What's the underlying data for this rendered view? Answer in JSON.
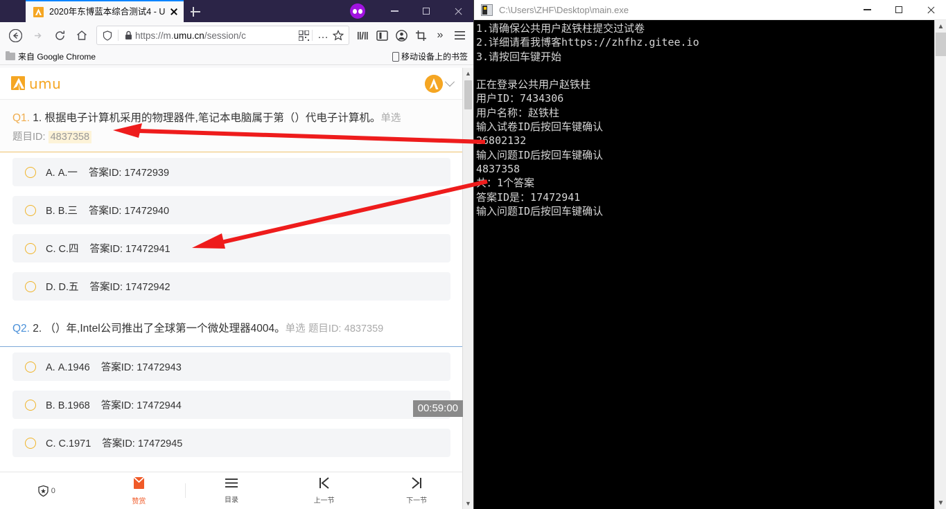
{
  "browser": {
    "tab": {
      "title": "2020年东博蓝本综合测试4 - U",
      "favicon_name": "umu-favicon"
    },
    "newtab_label": "+",
    "url": {
      "prefix": "https://m.",
      "domain": "umu.cn",
      "path": "/session/c"
    },
    "bookmarks": {
      "left": "来自 Google Chrome",
      "right": "移动设备上的书签"
    },
    "nav": {
      "back": "←",
      "forward": "→",
      "reload": "⟳",
      "home": "⌂",
      "shield": "shield-icon",
      "lock": "lock-icon",
      "more": "…",
      "star": "☆",
      "library": "library-icon",
      "sidebar": "sidebar-icon",
      "account": "account-icon",
      "screenshot": "screenshot-icon",
      "overflow": "»",
      "menu": "≡"
    }
  },
  "umu": {
    "brand": "umu",
    "questions": [
      {
        "num": "Q1.",
        "num_color": "#f0ad4e",
        "text": "1. 根据电子计算机采用的物理器件,笔记本电脑属于第（）代电子计算机。",
        "type": "单选",
        "id_label": "题目ID:",
        "id_value": "4837358",
        "options": [
          {
            "letter": "A.",
            "label": "A.一",
            "ans_label": "答案ID:",
            "ans_id": "17472939"
          },
          {
            "letter": "B.",
            "label": "B.三",
            "ans_label": "答案ID:",
            "ans_id": "17472940"
          },
          {
            "letter": "C.",
            "label": "C.四",
            "ans_label": "答案ID:",
            "ans_id": "17472941"
          },
          {
            "letter": "D.",
            "label": "D.五",
            "ans_label": "答案ID:",
            "ans_id": "17472942"
          }
        ]
      },
      {
        "num": "Q2.",
        "num_color": "#4a90d9",
        "text": "2. （）年,Intel公司推出了全球第一个微处理器4004。",
        "type": "单选",
        "id_label": "题目ID:",
        "id_value": "4837359",
        "options": [
          {
            "letter": "A.",
            "label": "A.1946",
            "ans_label": "答案ID:",
            "ans_id": "17472943"
          },
          {
            "letter": "B.",
            "label": "B.1968",
            "ans_label": "答案ID:",
            "ans_id": "17472944"
          },
          {
            "letter": "C.",
            "label": "C.1971",
            "ans_label": "答案ID:",
            "ans_id": "17472945"
          }
        ]
      }
    ],
    "timer": "00:59:00",
    "bottombar": [
      {
        "name": "likes",
        "icon": "shield-star-icon",
        "count": "0",
        "label": ""
      },
      {
        "name": "reward",
        "icon": "envelope-icon",
        "count": "",
        "label": "赞赏"
      },
      {
        "name": "catalog",
        "icon": "list-icon",
        "count": "",
        "label": "目录"
      },
      {
        "name": "prev-section",
        "icon": "prev-icon",
        "count": "",
        "label": "上一节"
      },
      {
        "name": "next-section",
        "icon": "next-icon",
        "count": "",
        "label": "下一节"
      }
    ]
  },
  "console": {
    "title": "C:\\Users\\ZHF\\Desktop\\main.exe",
    "output": "1.请确保公共用户赵铁柱提交过试卷\n2.详细请看我博客https://zhfhz.gitee.io\n3.请按回车键开始\n\n正在登录公共用户赵铁柱\n用户ID：7434306\n用户名称：赵铁柱\n输入试卷ID后按回车键确认\n26802132\n输入问题ID后按回车键确认\n4837358\n共：1个答案\n答案ID是：17472941\n输入问题ID后按回车键确认"
  },
  "annotations": {
    "arrow_color": "#ee1c1c",
    "arrow1_meaning": "question-id-maps-to-console-input",
    "arrow2_meaning": "answer-id-maps-to-console-output"
  }
}
